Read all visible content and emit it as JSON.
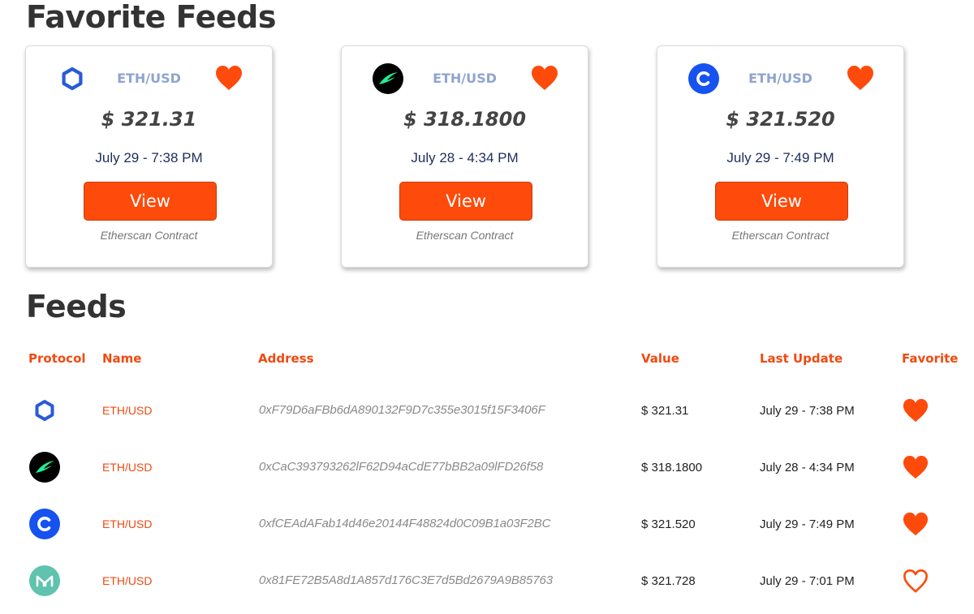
{
  "favorites_section": {
    "title": "Favorite Feeds"
  },
  "favorites": [
    {
      "protocol_icon": "chainlink-icon",
      "pair": "ETH/USD",
      "price": "$ 321.31",
      "date": "July 29 - 7:38 PM",
      "view_label": "View",
      "contract_label": "Etherscan Contract",
      "favorited": true
    },
    {
      "protocol_icon": "tellor-icon",
      "pair": "ETH/USD",
      "price": "$ 318.1800",
      "date": "July 28 - 4:34 PM",
      "view_label": "View",
      "contract_label": "Etherscan Contract",
      "favorited": true
    },
    {
      "protocol_icon": "coinbase-icon",
      "pair": "ETH/USD",
      "price": "$ 321.520",
      "date": "July 29 - 7:49 PM",
      "view_label": "View",
      "contract_label": "Etherscan Contract",
      "favorited": true
    }
  ],
  "feeds_section": {
    "title": "Feeds",
    "columns": [
      "Protocol",
      "Name",
      "Address",
      "Value",
      "Last Update",
      "Favorite"
    ]
  },
  "feeds": [
    {
      "protocol_icon": "chainlink-icon",
      "name": "ETH/USD",
      "address": "0xF79D6aFBb6dA890132F9D7c355e3015f15F3406F",
      "value": "$ 321.31",
      "last_update": "July 29 - 7:38 PM",
      "favorited": true
    },
    {
      "protocol_icon": "tellor-icon",
      "name": "ETH/USD",
      "address": "0xCaC393793262lF62D94aCdE77bBB2a09lFD26f58",
      "value": "$ 318.1800",
      "last_update": "July 28 - 4:34 PM",
      "favorited": true
    },
    {
      "protocol_icon": "coinbase-icon",
      "name": "ETH/USD",
      "address": "0xfCEAdAFab14d46e20144F48824d0C09B1a03F2BC",
      "value": "$ 321.520",
      "last_update": "July 29 - 7:49 PM",
      "favorited": true
    },
    {
      "protocol_icon": "maker-icon",
      "name": "ETH/USD",
      "address": "0x81FE72B5A8d1A857d176C3E7d5Bd2679A9B85763",
      "value": "$ 321.728",
      "last_update": "July 29 - 7:01 PM",
      "favorited": false
    }
  ],
  "colors": {
    "accent": "#fe4a0b",
    "heading": "#333333",
    "pair_label": "#8fa4cf",
    "date": "#1d2e5c",
    "chainlink": "#2a5ada",
    "coinbase": "#1652f0",
    "maker": "#5fc3ae",
    "tellor_bg": "#000000",
    "tellor_swoosh": "#20f092"
  }
}
